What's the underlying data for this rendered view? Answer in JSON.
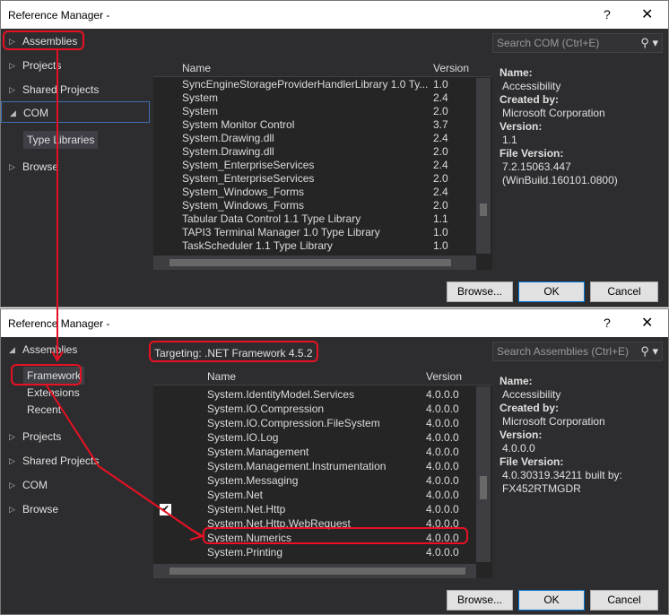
{
  "window1": {
    "title": "Reference Manager -",
    "help": "?",
    "close": "✕",
    "nav": {
      "assemblies": "Assemblies",
      "projects": "Projects",
      "shared": "Shared Projects",
      "com": "COM",
      "typelib": "Type Libraries",
      "browse": "Browse"
    },
    "search_placeholder": "Search COM (Ctrl+E)",
    "columns": {
      "name": "Name",
      "version": "Version"
    },
    "rows": [
      {
        "name": "SyncEngineStorageProviderHandlerLibrary 1.0 Ty...",
        "version": "1.0"
      },
      {
        "name": "System",
        "version": "2.4"
      },
      {
        "name": "System",
        "version": "2.0"
      },
      {
        "name": "System Monitor Control",
        "version": "3.7"
      },
      {
        "name": "System.Drawing.dll",
        "version": "2.4"
      },
      {
        "name": "System.Drawing.dll",
        "version": "2.0"
      },
      {
        "name": "System_EnterpriseServices",
        "version": "2.4"
      },
      {
        "name": "System_EnterpriseServices",
        "version": "2.0"
      },
      {
        "name": "System_Windows_Forms",
        "version": "2.4"
      },
      {
        "name": "System_Windows_Forms",
        "version": "2.0"
      },
      {
        "name": "Tabular Data Control 1.1 Type Library",
        "version": "1.1"
      },
      {
        "name": "TAPI3 Terminal Manager 1.0 Type Library",
        "version": "1.0"
      },
      {
        "name": "TaskScheduler 1.1 Type Library",
        "version": "1.0"
      }
    ],
    "details": {
      "name_label": "Name:",
      "name": "Accessibility",
      "created_label": "Created by:",
      "created": "Microsoft Corporation",
      "version_label": "Version:",
      "version": "1.1",
      "file_label": "File Version:",
      "file1": "7.2.15063.447",
      "file2": "(WinBuild.160101.0800)"
    },
    "buttons": {
      "browse": "Browse...",
      "ok": "OK",
      "cancel": "Cancel"
    }
  },
  "window2": {
    "title": "Reference Manager -",
    "help": "?",
    "close": "✕",
    "nav": {
      "assemblies": "Assemblies",
      "framework": "Framework",
      "extensions": "Extensions",
      "recent": "Recent",
      "projects": "Projects",
      "shared": "Shared Projects",
      "com": "COM",
      "browse": "Browse"
    },
    "targeting": "Targeting: .NET Framework 4.5.2",
    "search_placeholder": "Search Assemblies (Ctrl+E)",
    "columns": {
      "name": "Name",
      "version": "Version"
    },
    "rows": [
      {
        "name": "System.IdentityModel.Services",
        "version": "4.0.0.0"
      },
      {
        "name": "System.IO.Compression",
        "version": "4.0.0.0"
      },
      {
        "name": "System.IO.Compression.FileSystem",
        "version": "4.0.0.0"
      },
      {
        "name": "System.IO.Log",
        "version": "4.0.0.0"
      },
      {
        "name": "System.Management",
        "version": "4.0.0.0"
      },
      {
        "name": "System.Management.Instrumentation",
        "version": "4.0.0.0"
      },
      {
        "name": "System.Messaging",
        "version": "4.0.0.0"
      },
      {
        "name": "System.Net",
        "version": "4.0.0.0"
      },
      {
        "name": "System.Net.Http",
        "version": "4.0.0.0",
        "checked": true
      },
      {
        "name": "System.Net.Http.WebRequest",
        "version": "4.0.0.0"
      },
      {
        "name": "System.Numerics",
        "version": "4.0.0.0"
      },
      {
        "name": "System.Printing",
        "version": "4.0.0.0"
      }
    ],
    "details": {
      "name_label": "Name:",
      "name": "Accessibility",
      "created_label": "Created by:",
      "created": "Microsoft Corporation",
      "version_label": "Version:",
      "version": "4.0.0.0",
      "file_label": "File Version:",
      "file1": "4.0.30319.34211 built by:",
      "file2": "FX452RTMGDR"
    },
    "buttons": {
      "browse": "Browse...",
      "ok": "OK",
      "cancel": "Cancel"
    },
    "checkmark": "✔"
  },
  "colors": {
    "background": "#2d2d30",
    "annotation": "#e81123",
    "selection": "#3e6fb1"
  },
  "icons": {
    "search": "search-icon",
    "expand": "triangle-right-icon",
    "collapse": "triangle-down-icon"
  }
}
